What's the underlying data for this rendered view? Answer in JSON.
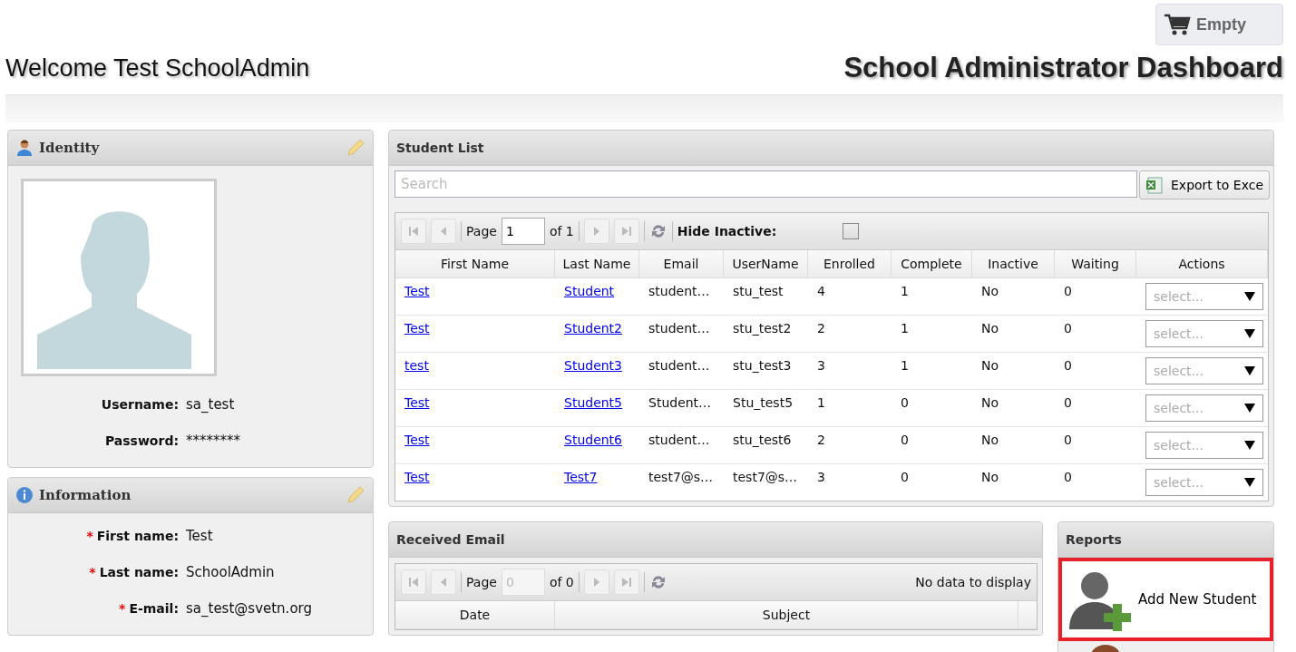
{
  "header": {
    "cart_button": "Empty",
    "welcome": "Welcome Test SchoolAdmin",
    "dashboard_title": "School Administrator Dashboard"
  },
  "identity": {
    "title": "Identity",
    "fields": [
      {
        "label": "Username:",
        "value": "sa_test"
      },
      {
        "label": "Password:",
        "value": "********"
      }
    ]
  },
  "information": {
    "title": "Information",
    "fields": [
      {
        "label": "First name:",
        "value": "Test",
        "required_mark": "*"
      },
      {
        "label": "Last name:",
        "value": "SchoolAdmin",
        "required_mark": "*"
      },
      {
        "label": "E-mail:",
        "value": "sa_test@svetn.org",
        "required_mark": "*"
      }
    ]
  },
  "student_list": {
    "title": "Student List",
    "search": {
      "placeholder": "Search"
    },
    "export_button": "Export to Exce",
    "pager": {
      "page_label": "Page",
      "page_value": "1",
      "of_label": "of 1"
    },
    "hide_inactive": {
      "label": "Hide Inactive:",
      "checked": false
    },
    "columns": [
      {
        "label": "First Name",
        "kind": "link"
      },
      {
        "label": "Last Name",
        "kind": "link"
      },
      {
        "label": "Email",
        "kind": "text"
      },
      {
        "label": "UserName",
        "kind": "text"
      },
      {
        "label": "Enrolled",
        "kind": "text"
      },
      {
        "label": "Complete",
        "kind": "text"
      },
      {
        "label": "Inactive",
        "kind": "text"
      },
      {
        "label": "Waiting",
        "kind": "text"
      },
      {
        "label": "Actions",
        "kind": "select"
      }
    ],
    "rows": [
      {
        "cells": [
          "Test",
          "Student",
          "student…",
          "stu_test",
          "4",
          "1",
          "No",
          "0",
          "select..."
        ]
      },
      {
        "cells": [
          "Test",
          "Student2",
          "student…",
          "stu_test2",
          "2",
          "1",
          "No",
          "0",
          "select..."
        ]
      },
      {
        "cells": [
          "test",
          "Student3",
          "student…",
          "stu_test3",
          "3",
          "1",
          "No",
          "0",
          "select..."
        ]
      },
      {
        "cells": [
          "Test",
          "Student5",
          "Student…",
          "Stu_test5",
          "1",
          "0",
          "No",
          "0",
          "select..."
        ]
      },
      {
        "cells": [
          "Test",
          "Student6",
          "student…",
          "stu_test6",
          "2",
          "0",
          "No",
          "0",
          "select..."
        ]
      },
      {
        "cells": [
          "Test",
          "Test7",
          "test7@s…",
          "test7@s…",
          "3",
          "0",
          "No",
          "0",
          "select..."
        ]
      }
    ]
  },
  "received_email": {
    "title": "Received Email",
    "pager": {
      "page_label": "Page",
      "page_value": "0",
      "of_label": "of 0",
      "status": "No data to display"
    },
    "columns": [
      "Date",
      "Subject"
    ]
  },
  "reports": {
    "title": "Reports",
    "items": [
      {
        "label": "Add New Student",
        "highlighted": true
      }
    ]
  }
}
